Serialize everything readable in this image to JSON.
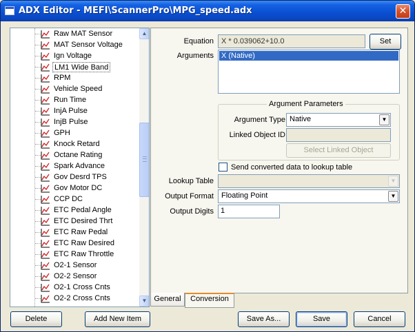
{
  "window": {
    "title": "ADX Editor - MEFI\\ScannerPro\\MPG_speed.adx",
    "close_glyph": "✕"
  },
  "tree": {
    "items": [
      "Raw MAT Sensor",
      "MAT Sensor Voltage",
      "Ign Voltage",
      "LM1 Wide Band",
      "RPM",
      "Vehicle Speed",
      "Run Time",
      "InjA Pulse",
      "InjB Pulse",
      "GPH",
      "Knock Retard",
      "Octane Rating",
      "Spark Advance",
      "Gov Desrd TPS",
      "Gov Motor DC",
      "CCP DC",
      "ETC Pedal Angle",
      "ETC Desired Thrt",
      "ETC Raw Pedal",
      "ETC Raw Desired",
      "ETC Raw Throttle",
      "O2-1 Sensor",
      "O2-2 Sensor",
      "O2-1 Cross Cnts",
      "O2-2 Cross Cnts"
    ],
    "selected_index": 3,
    "item_icon": "gauge-graph-icon",
    "scroll_up_glyph": "▲",
    "scroll_down_glyph": "▼"
  },
  "conversion": {
    "equation_label": "Equation",
    "equation_value": "X * 0.039062+10.0",
    "set_button": "Set",
    "arguments_label": "Arguments",
    "arguments": [
      "X (Native)"
    ],
    "arg_params_title": "Argument Parameters",
    "argument_type_label": "Argument Type",
    "argument_type_value": "Native",
    "linked_object_label": "Linked Object ID",
    "linked_object_value": "",
    "select_linked_button": "Select Linked Object",
    "send_lookup_label": "Send converted data to lookup table",
    "send_lookup_checked": false,
    "lookup_table_label": "Lookup Table",
    "lookup_table_value": "",
    "output_format_label": "Output Format",
    "output_format_value": "Floating Point",
    "output_digits_label": "Output Digits",
    "output_digits_value": "1",
    "dropdown_glyph": "▼"
  },
  "tabs": [
    {
      "label": "General",
      "active": false
    },
    {
      "label": "Conversion",
      "active": true
    }
  ],
  "footer": {
    "delete": "Delete",
    "add_new_item": "Add New Item",
    "save_as": "Save As...",
    "save": "Save",
    "cancel": "Cancel"
  },
  "colors": {
    "titlebar": "#0a4fd0",
    "selection": "#316ac5",
    "icon_red": "#d02020"
  }
}
